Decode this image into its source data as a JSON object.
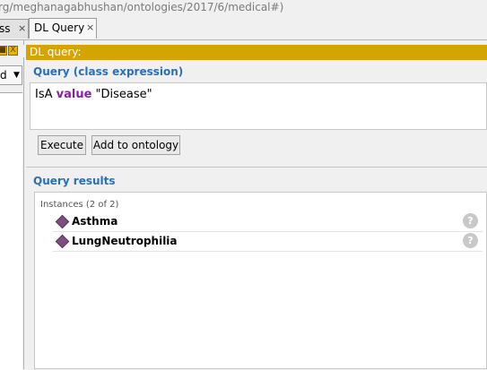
{
  "url_fragment": "rg/meghanagabhushan/ontologies/2017/6/medical#)",
  "tabs": [
    {
      "label": "ss",
      "close": "×"
    },
    {
      "label": "DL Query",
      "close": "×"
    }
  ],
  "sidebar": {
    "buttons": [
      "■",
      "X"
    ],
    "combo_value": "d",
    "combo_arrow": "▼"
  },
  "dl_query": {
    "header": "DL query:",
    "query_section_title": "Query (class expression)",
    "query": {
      "prefix": "IsA ",
      "keyword": "value",
      "suffix": " \"Disease\""
    },
    "execute_label": "Execute",
    "add_label": "Add to ontology",
    "results_title": "Query results",
    "instances_label": "Instances (2 of 2)",
    "results": [
      {
        "label": "Asthma",
        "help": "?"
      },
      {
        "label": "LungNeutrophilia",
        "help": "?"
      }
    ]
  },
  "icons": {
    "instance_icon": "individual-diamond-icon",
    "help_icon": "help-icon"
  },
  "colors": {
    "header_bar": "#d6a400",
    "section_title": "#2e6eb6",
    "keyword": "#8b1fa8",
    "instance_icon": "#7a4f7e"
  }
}
